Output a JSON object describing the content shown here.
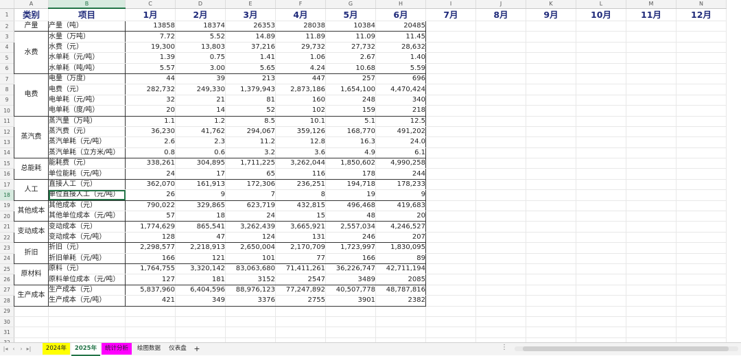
{
  "columns": [
    "A",
    "B",
    "C",
    "D",
    "E",
    "F",
    "G",
    "H",
    "I",
    "J",
    "K",
    "L",
    "M",
    "N"
  ],
  "header": {
    "category_label": "类别",
    "item_label": "项目",
    "months": [
      "1月",
      "2月",
      "3月",
      "4月",
      "5月",
      "6月",
      "7月",
      "8月",
      "9月",
      "10月",
      "11月",
      "12月"
    ]
  },
  "groups": [
    {
      "category": "产量",
      "rows": [
        {
          "item": "产量（吨）",
          "values": [
            "13858",
            "18374",
            "26353",
            "28038",
            "10384",
            "20485"
          ]
        }
      ]
    },
    {
      "category": "水费",
      "rows": [
        {
          "item": "水量（万吨）",
          "values": [
            "7.72",
            "5.52",
            "14.89",
            "11.89",
            "11.09",
            "11.45"
          ]
        },
        {
          "item": "水费（元）",
          "values": [
            "19,300",
            "13,803",
            "37,216",
            "29,732",
            "27,732",
            "28,632"
          ]
        },
        {
          "item": "水单耗（元/吨）",
          "values": [
            "1.39",
            "0.75",
            "1.41",
            "1.06",
            "2.67",
            "1.40"
          ]
        },
        {
          "item": "水单耗（吨/吨）",
          "values": [
            "5.57",
            "3.00",
            "5.65",
            "4.24",
            "10.68",
            "5.59"
          ]
        }
      ]
    },
    {
      "category": "电费",
      "rows": [
        {
          "item": "电量（万度）",
          "values": [
            "44",
            "39",
            "213",
            "447",
            "257",
            "696"
          ]
        },
        {
          "item": "电费（元）",
          "values": [
            "282,732",
            "249,330",
            "1,379,943",
            "2,873,186",
            "1,654,100",
            "4,470,424"
          ]
        },
        {
          "item": "电单耗（元/吨）",
          "values": [
            "32",
            "21",
            "81",
            "160",
            "248",
            "340"
          ]
        },
        {
          "item": "电单耗（度/吨）",
          "values": [
            "20",
            "14",
            "52",
            "102",
            "159",
            "218"
          ]
        }
      ]
    },
    {
      "category": "蒸汽费",
      "rows": [
        {
          "item": "蒸汽量（万吨）",
          "values": [
            "1.1",
            "1.2",
            "8.5",
            "10.1",
            "5.1",
            "12.5"
          ]
        },
        {
          "item": "蒸汽费（元）",
          "values": [
            "36,230",
            "41,762",
            "294,067",
            "359,126",
            "168,770",
            "491,202"
          ]
        },
        {
          "item": "蒸汽单耗（元/吨）",
          "values": [
            "2.6",
            "2.3",
            "11.2",
            "12.8",
            "16.3",
            "24.0"
          ]
        },
        {
          "item": "蒸汽单耗（立方米/吨）",
          "values": [
            "0.8",
            "0.6",
            "3.2",
            "3.6",
            "4.9",
            "6.1"
          ]
        }
      ]
    },
    {
      "category": "总能耗",
      "rows": [
        {
          "item": "能耗费（元）",
          "values": [
            "338,261",
            "304,895",
            "1,711,225",
            "3,262,044",
            "1,850,602",
            "4,990,258"
          ]
        },
        {
          "item": "单位能耗（元/吨）",
          "values": [
            "24",
            "17",
            "65",
            "116",
            "178",
            "244"
          ]
        }
      ]
    },
    {
      "category": "人工",
      "rows": [
        {
          "item": "直接人工（元）",
          "values": [
            "362,070",
            "161,913",
            "172,306",
            "236,251",
            "194,718",
            "178,233"
          ]
        },
        {
          "item": "单位直接人工（元/吨）",
          "values": [
            "26",
            "9",
            "7",
            "8",
            "19",
            "9"
          ]
        }
      ]
    },
    {
      "category": "其他成本",
      "rows": [
        {
          "item": "其他成本（元）",
          "values": [
            "790,022",
            "329,865",
            "623,719",
            "432,815",
            "496,468",
            "419,683"
          ]
        },
        {
          "item": "其他单位成本（元/吨）",
          "values": [
            "57",
            "18",
            "24",
            "15",
            "48",
            "20"
          ]
        }
      ]
    },
    {
      "category": "变动成本",
      "rows": [
        {
          "item": "变动成本（元）",
          "values": [
            "1,774,629",
            "865,541",
            "3,262,439",
            "3,665,921",
            "2,557,034",
            "4,246,527"
          ]
        },
        {
          "item": "变动成本（元/吨）",
          "values": [
            "128",
            "47",
            "124",
            "131",
            "246",
            "207"
          ]
        }
      ]
    },
    {
      "category": "折旧",
      "rows": [
        {
          "item": "折旧（元）",
          "values": [
            "2,298,577",
            "2,218,913",
            "2,650,004",
            "2,170,709",
            "1,723,997",
            "1,830,095"
          ]
        },
        {
          "item": "折旧单耗（元/吨）",
          "values": [
            "166",
            "121",
            "101",
            "77",
            "166",
            "89"
          ]
        }
      ]
    },
    {
      "category": "原材料",
      "rows": [
        {
          "item": "原料（元）",
          "values": [
            "1,764,755",
            "3,320,142",
            "83,063,680",
            "71,411,261",
            "36,226,747",
            "42,711,194"
          ]
        },
        {
          "item": "原料单位成本（元/吨）",
          "values": [
            "127",
            "181",
            "3152",
            "2547",
            "3489",
            "2085"
          ]
        }
      ]
    },
    {
      "category": "生产成本",
      "rows": [
        {
          "item": "生产成本（元）",
          "values": [
            "5,837,960",
            "6,404,596",
            "88,976,123",
            "77,247,892",
            "40,507,778",
            "48,787,816"
          ]
        },
        {
          "item": "生产成本（元/吨）",
          "values": [
            "421",
            "349",
            "3376",
            "2755",
            "3901",
            "2382"
          ]
        }
      ]
    }
  ],
  "selected_cell": "B18",
  "row_count": 34,
  "tabs": [
    {
      "label": "2024年",
      "bg": "#ffff00",
      "active": false
    },
    {
      "label": "2025年",
      "bg": "#ffffff",
      "active": true
    },
    {
      "label": "统计分析",
      "bg": "#ff00ff",
      "active": false
    },
    {
      "label": "绘图数据",
      "bg": "#f3f3f3",
      "active": false
    },
    {
      "label": "仪表盘",
      "bg": "#f3f3f3",
      "active": false
    }
  ],
  "add_sheet": "+",
  "colors": {
    "accent": "#217346",
    "header_text": "#1f2a7a"
  }
}
